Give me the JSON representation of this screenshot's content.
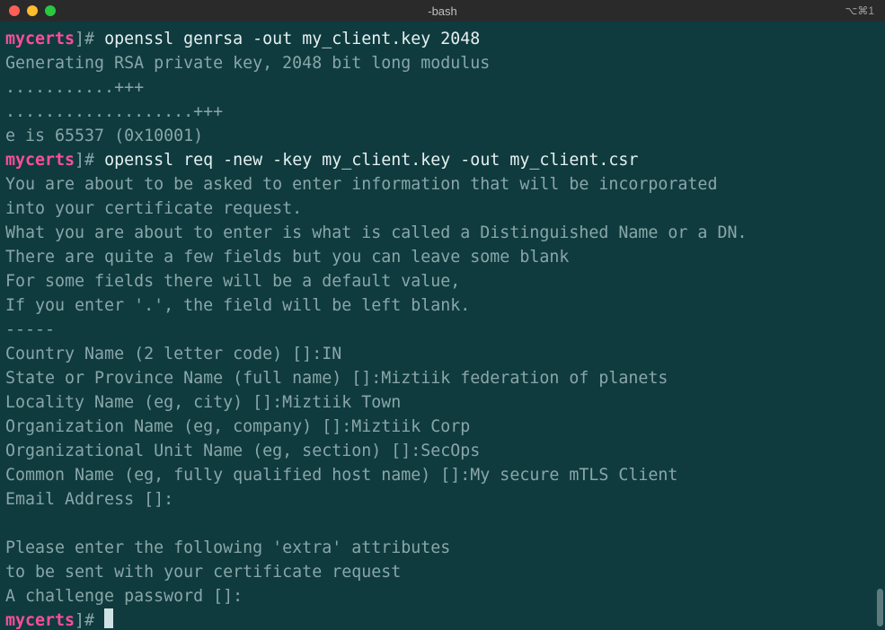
{
  "window": {
    "title": "-bash",
    "right_indicator": "⌥⌘1"
  },
  "prompt": {
    "dir": "mycerts",
    "suffix": "]# "
  },
  "lines": [
    {
      "t": "cmd",
      "cmd": "openssl genrsa -out my_client.key 2048"
    },
    {
      "t": "out",
      "text": "Generating RSA private key, 2048 bit long modulus"
    },
    {
      "t": "out",
      "text": "...........+++"
    },
    {
      "t": "out",
      "text": "...................+++"
    },
    {
      "t": "out",
      "text": "e is 65537 (0x10001)"
    },
    {
      "t": "cmd",
      "cmd": "openssl req -new -key my_client.key -out my_client.csr"
    },
    {
      "t": "out",
      "text": "You are about to be asked to enter information that will be incorporated"
    },
    {
      "t": "out",
      "text": "into your certificate request."
    },
    {
      "t": "out",
      "text": "What you are about to enter is what is called a Distinguished Name or a DN."
    },
    {
      "t": "out",
      "text": "There are quite a few fields but you can leave some blank"
    },
    {
      "t": "out",
      "text": "For some fields there will be a default value,"
    },
    {
      "t": "out",
      "text": "If you enter '.', the field will be left blank."
    },
    {
      "t": "out",
      "text": "-----"
    },
    {
      "t": "out",
      "text": "Country Name (2 letter code) []:IN"
    },
    {
      "t": "out",
      "text": "State or Province Name (full name) []:Miztiik federation of planets"
    },
    {
      "t": "out",
      "text": "Locality Name (eg, city) []:Miztiik Town"
    },
    {
      "t": "out",
      "text": "Organization Name (eg, company) []:Miztiik Corp"
    },
    {
      "t": "out",
      "text": "Organizational Unit Name (eg, section) []:SecOps"
    },
    {
      "t": "out",
      "text": "Common Name (eg, fully qualified host name) []:My secure mTLS Client"
    },
    {
      "t": "out",
      "text": "Email Address []:"
    },
    {
      "t": "out",
      "text": ""
    },
    {
      "t": "out",
      "text": "Please enter the following 'extra' attributes"
    },
    {
      "t": "out",
      "text": "to be sent with your certificate request"
    },
    {
      "t": "out",
      "text": "A challenge password []:"
    },
    {
      "t": "prompt"
    }
  ]
}
